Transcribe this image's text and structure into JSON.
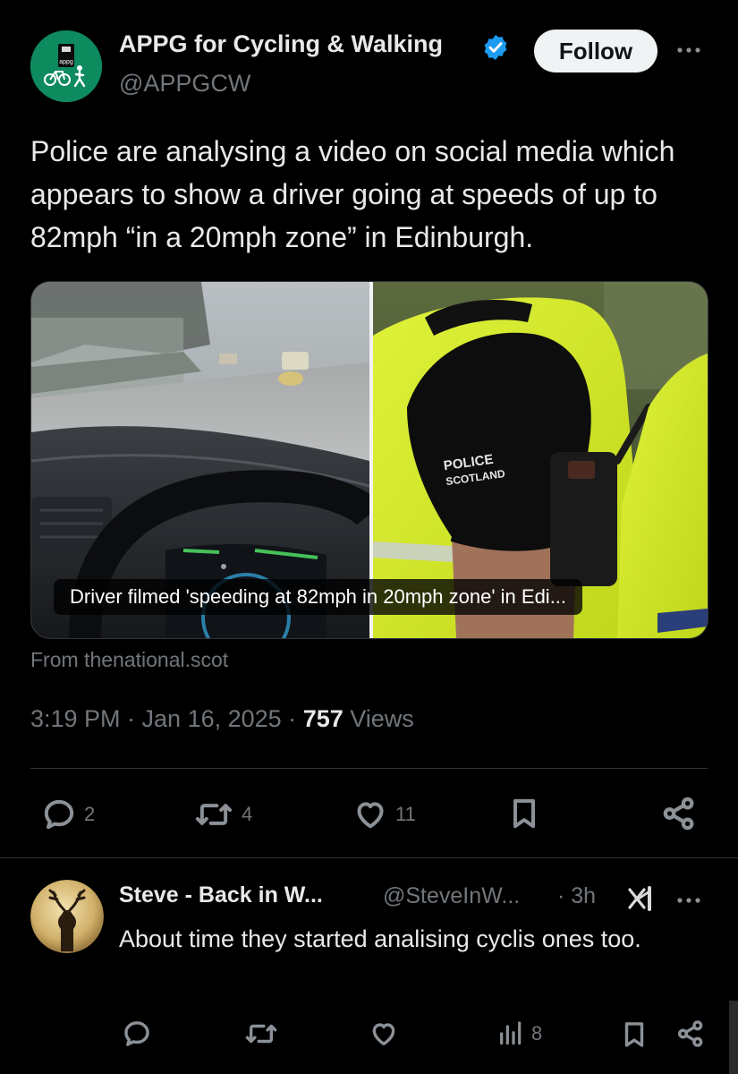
{
  "post": {
    "author_name": "APPG for Cycling & Walking",
    "handle": "@APPGCW",
    "follow_label": "Follow",
    "avatar_text": "appg",
    "text": "Police are analysing a video on social media which appears to show a driver going at speeds of up to 82mph “in a 20mph zone” in Edinburgh.",
    "media": {
      "caption": "Driver filmed 'speeding at 82mph in 20mph zone' in Edi...",
      "sleeve_text_line1": "POLICE",
      "sleeve_text_line2": "SCOTLAND"
    },
    "source": "From thenational.scot",
    "timestamp": "3:19 PM · Jan 16, 2025 · ",
    "views_count": "757",
    "views_label": " Views",
    "actions": {
      "replies": "2",
      "reposts": "4",
      "likes": "11"
    }
  },
  "reply": {
    "name": "Steve - Back in W...",
    "handle": "@SteveInW...",
    "time": "· 3h",
    "text": "About time they started analising cyclis ones too.",
    "actions": {
      "views": "8"
    }
  },
  "colors": {
    "background": "#000000",
    "text_primary": "#e7e9ea",
    "text_secondary": "#71767b",
    "verified": "#1d9bf0",
    "avatar_bg": "#0e8a5f",
    "hi_vis": "#d7ec1f"
  },
  "icons": [
    "verified-badge-icon",
    "more-icon",
    "reply-icon",
    "repost-icon",
    "like-icon",
    "bookmark-icon",
    "share-icon",
    "views-icon",
    "grok-icon"
  ]
}
